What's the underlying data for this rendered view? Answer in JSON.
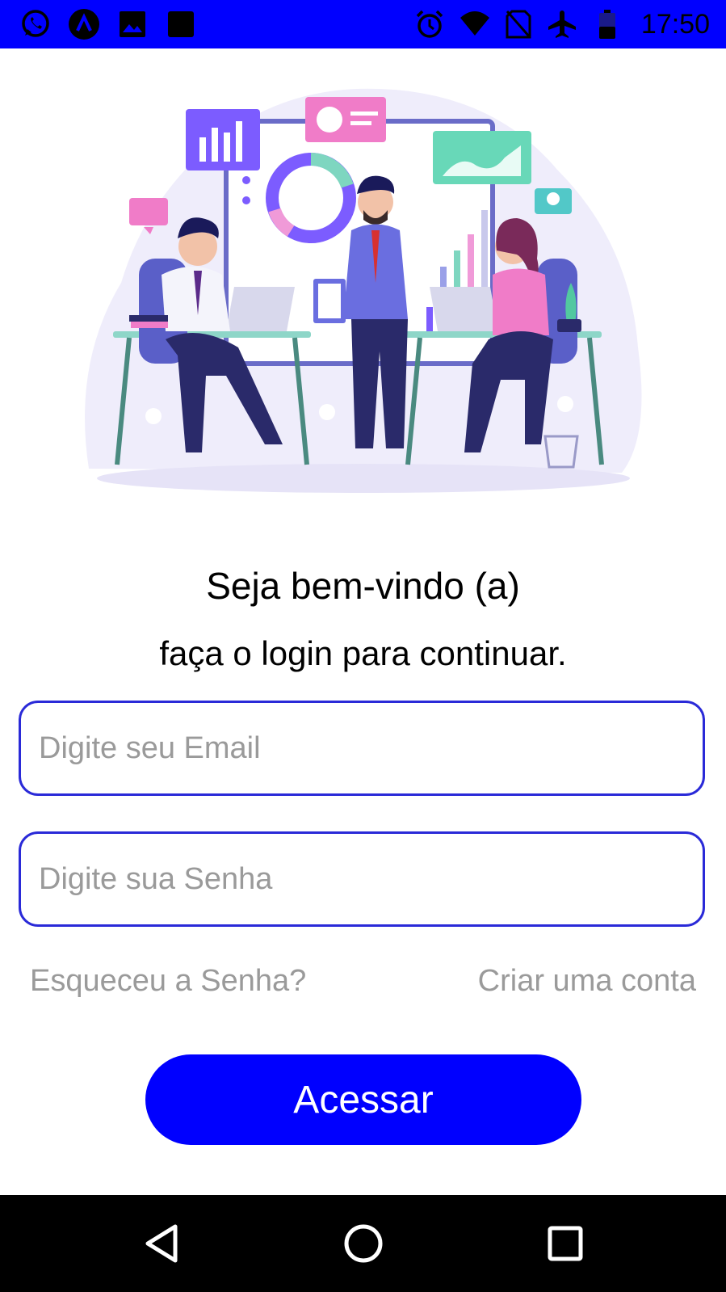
{
  "status_bar": {
    "time": "17:50",
    "background_color": "#0000ff",
    "left_icons": [
      "whatsapp-icon",
      "app-a-icon",
      "gallery-icon",
      "square-app-icon"
    ],
    "right_icons": [
      "alarm-icon",
      "wifi-icon",
      "no-sim-icon",
      "airplane-mode-icon",
      "battery-icon"
    ]
  },
  "illustration": {
    "name": "team-meeting-illustration"
  },
  "welcome": {
    "title": "Seja bem-vindo (a)",
    "subtitle": "faça o login para continuar."
  },
  "form": {
    "email_placeholder": "Digite seu Email",
    "email_value": "",
    "password_placeholder": "Digite sua Senha",
    "password_value": "",
    "forgot_password_label": "Esqueceu a Senha?",
    "create_account_label": "Criar uma conta",
    "submit_label": "Acessar",
    "accent_color": "#0000ff",
    "border_color": "#2a2ad8"
  },
  "nav_bar": {
    "buttons": [
      "back-icon",
      "home-icon",
      "recents-icon"
    ]
  }
}
